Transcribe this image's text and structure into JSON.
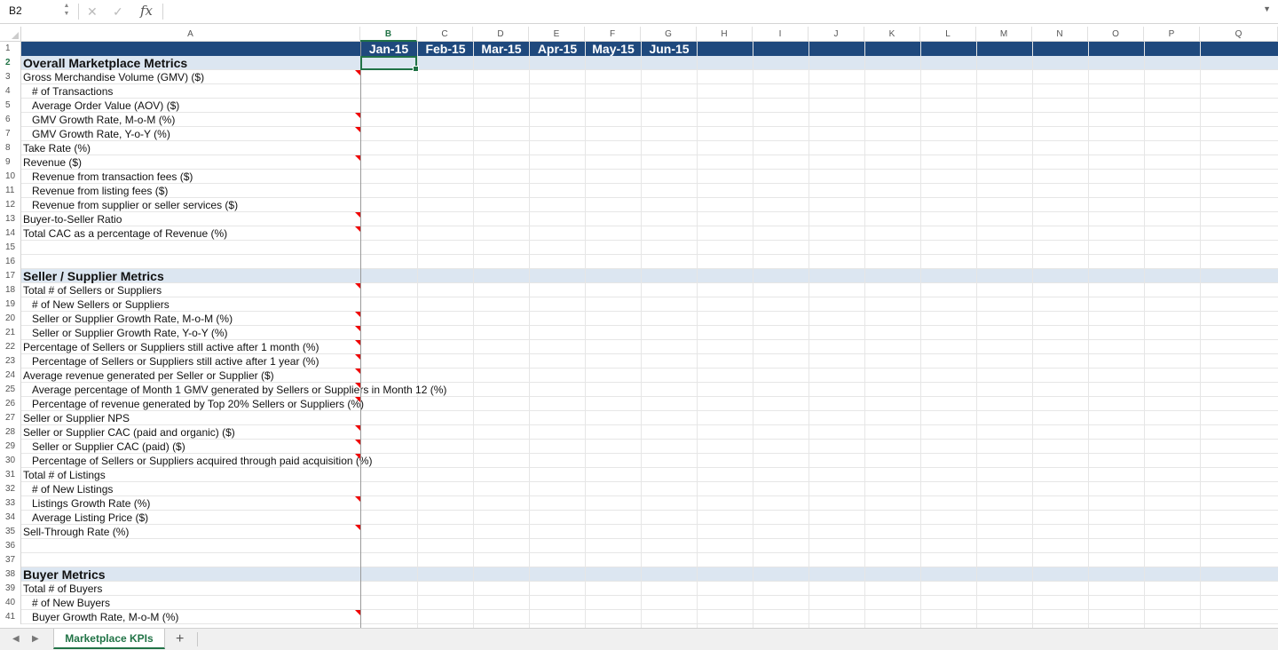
{
  "formula_bar": {
    "name_box": "B2",
    "fx_label": "fx",
    "formula": ""
  },
  "columns": [
    "A",
    "B",
    "C",
    "D",
    "E",
    "F",
    "G",
    "H",
    "I",
    "J",
    "K",
    "L",
    "M",
    "N",
    "O",
    "P",
    "Q"
  ],
  "months": [
    "Jan-15",
    "Feb-15",
    "Mar-15",
    "Apr-15",
    "May-15",
    "Jun-15"
  ],
  "colors": {
    "header_bg": "#1f497d",
    "section_bg": "#dce6f1",
    "accent": "#217346",
    "comment_marker": "#ff0000"
  },
  "rows": [
    {
      "n": "1",
      "text": "",
      "kind": "header"
    },
    {
      "n": "2",
      "text": "Overall Marketplace Metrics",
      "kind": "section"
    },
    {
      "n": "3",
      "text": "Gross Merchandise Volume (GMV) ($)",
      "kind": "item",
      "comment": true
    },
    {
      "n": "4",
      "text": "# of Transactions",
      "kind": "sub"
    },
    {
      "n": "5",
      "text": "Average Order Value (AOV) ($)",
      "kind": "sub"
    },
    {
      "n": "6",
      "text": "GMV Growth Rate, M-o-M (%)",
      "kind": "sub",
      "comment": true
    },
    {
      "n": "7",
      "text": "GMV Growth Rate, Y-o-Y (%)",
      "kind": "sub",
      "comment": true
    },
    {
      "n": "8",
      "text": "Take Rate (%)",
      "kind": "item"
    },
    {
      "n": "9",
      "text": "Revenue ($)",
      "kind": "item",
      "comment": true
    },
    {
      "n": "10",
      "text": "Revenue from transaction fees ($)",
      "kind": "sub"
    },
    {
      "n": "11",
      "text": "Revenue from listing fees ($)",
      "kind": "sub"
    },
    {
      "n": "12",
      "text": "Revenue from supplier or seller services ($)",
      "kind": "sub"
    },
    {
      "n": "13",
      "text": "Buyer-to-Seller Ratio",
      "kind": "item",
      "comment": true
    },
    {
      "n": "14",
      "text": "Total CAC as a percentage of Revenue (%)",
      "kind": "item",
      "comment": true
    },
    {
      "n": "15",
      "text": "",
      "kind": "item"
    },
    {
      "n": "16",
      "text": "",
      "kind": "item"
    },
    {
      "n": "17",
      "text": "Seller / Supplier Metrics",
      "kind": "section"
    },
    {
      "n": "18",
      "text": "Total # of Sellers or Suppliers",
      "kind": "item",
      "comment": true
    },
    {
      "n": "19",
      "text": "# of New Sellers or Suppliers",
      "kind": "sub"
    },
    {
      "n": "20",
      "text": "Seller or Supplier Growth Rate, M-o-M (%)",
      "kind": "sub",
      "comment": true
    },
    {
      "n": "21",
      "text": "Seller or Supplier Growth Rate, Y-o-Y (%)",
      "kind": "sub",
      "comment": true
    },
    {
      "n": "22",
      "text": "Percentage of Sellers or Suppliers still active after 1 month (%)",
      "kind": "item",
      "comment": true
    },
    {
      "n": "23",
      "text": "Percentage of Sellers or Suppliers still active after 1 year (%)",
      "kind": "sub",
      "comment": true
    },
    {
      "n": "24",
      "text": "Average revenue generated per Seller or Supplier ($)",
      "kind": "item",
      "comment": true
    },
    {
      "n": "25",
      "text": "Average percentage of Month 1 GMV generated by Sellers or Suppliers in Month 12 (%)",
      "kind": "sub",
      "comment": true
    },
    {
      "n": "26",
      "text": "Percentage of revenue generated by Top 20% Sellers or Suppliers (%)",
      "kind": "sub",
      "comment": true
    },
    {
      "n": "27",
      "text": "Seller or Supplier NPS",
      "kind": "item"
    },
    {
      "n": "28",
      "text": "Seller or Supplier CAC (paid and organic) ($)",
      "kind": "item",
      "comment": true
    },
    {
      "n": "29",
      "text": "Seller or Supplier CAC (paid) ($)",
      "kind": "sub",
      "comment": true
    },
    {
      "n": "30",
      "text": "Percentage of Sellers or Suppliers acquired through paid acquisition (%)",
      "kind": "sub",
      "comment": true
    },
    {
      "n": "31",
      "text": "Total # of Listings",
      "kind": "item"
    },
    {
      "n": "32",
      "text": "# of New Listings",
      "kind": "sub"
    },
    {
      "n": "33",
      "text": "Listings Growth Rate (%)",
      "kind": "sub",
      "comment": true
    },
    {
      "n": "34",
      "text": "Average Listing Price ($)",
      "kind": "sub"
    },
    {
      "n": "35",
      "text": "Sell-Through Rate (%)",
      "kind": "item",
      "comment": true
    },
    {
      "n": "36",
      "text": "",
      "kind": "item"
    },
    {
      "n": "37",
      "text": "",
      "kind": "item"
    },
    {
      "n": "38",
      "text": "Buyer Metrics",
      "kind": "section"
    },
    {
      "n": "39",
      "text": "Total # of Buyers",
      "kind": "item"
    },
    {
      "n": "40",
      "text": "# of New Buyers",
      "kind": "sub"
    },
    {
      "n": "41",
      "text": "Buyer Growth Rate, M-o-M (%)",
      "kind": "sub",
      "comment": true
    }
  ],
  "sheet_tabs": {
    "active": "Marketplace KPIs",
    "add": "+"
  }
}
